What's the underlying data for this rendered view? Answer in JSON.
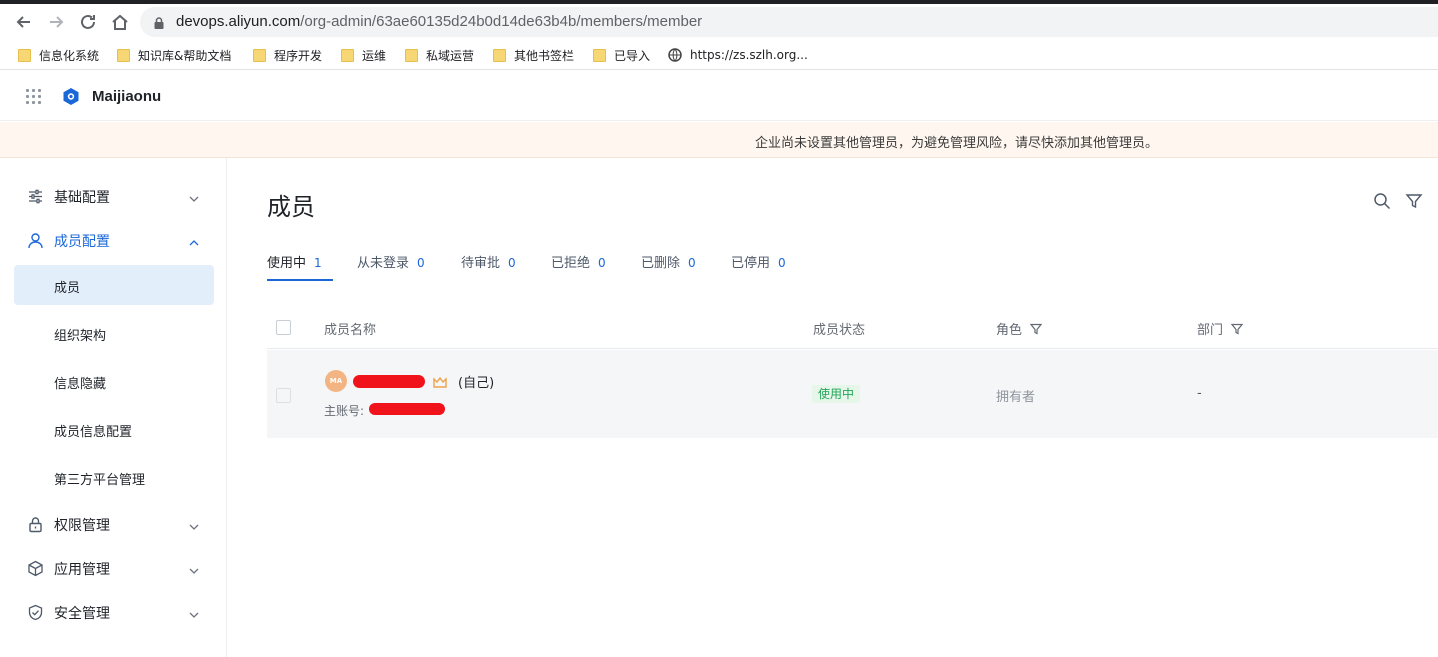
{
  "browser": {
    "url_host": "devops.aliyun.com",
    "url_path": "/org-admin/63ae60135d24b0d14de63b4b/members/member",
    "bookmarks": [
      "信息化系统",
      "知识库&帮助文档",
      "程序开发",
      "运维",
      "私域运营",
      "其他书签栏",
      "已导入",
      "https://zs.szlh.org..."
    ]
  },
  "header": {
    "org_name": "Maijiaonu"
  },
  "notice": "企业尚未设置其他管理员，为避免管理风险，请尽快添加其他管理员。",
  "sidebar": {
    "groups": [
      {
        "label": "基础配置",
        "icon": "sliders-icon"
      },
      {
        "label": "成员配置",
        "icon": "user-icon"
      },
      {
        "label": "权限管理",
        "icon": "lock-icon"
      },
      {
        "label": "应用管理",
        "icon": "cube-icon"
      },
      {
        "label": "安全管理",
        "icon": "shield-icon"
      }
    ],
    "sub_items": [
      "成员",
      "组织架构",
      "信息隐藏",
      "成员信息配置",
      "第三方平台管理"
    ]
  },
  "main": {
    "title": "成员",
    "tabs": [
      {
        "label": "使用中",
        "count": "1"
      },
      {
        "label": "从未登录",
        "count": "0"
      },
      {
        "label": "待审批",
        "count": "0"
      },
      {
        "label": "已拒绝",
        "count": "0"
      },
      {
        "label": "已删除",
        "count": "0"
      },
      {
        "label": "已停用",
        "count": "0"
      }
    ],
    "columns": [
      "成员名称",
      "成员状态",
      "角色",
      "部门"
    ],
    "rows": [
      {
        "avatar_initials": "MA",
        "self_tag": "(自己)",
        "sub_account_label": "主账号:",
        "status": "使用中",
        "role": "拥有者",
        "department": "-"
      }
    ]
  },
  "colors": {
    "accent": "#1b67d8",
    "notice_bg": "#fff7ef",
    "status_green": "#23a559",
    "redaction": "#f0131b"
  }
}
